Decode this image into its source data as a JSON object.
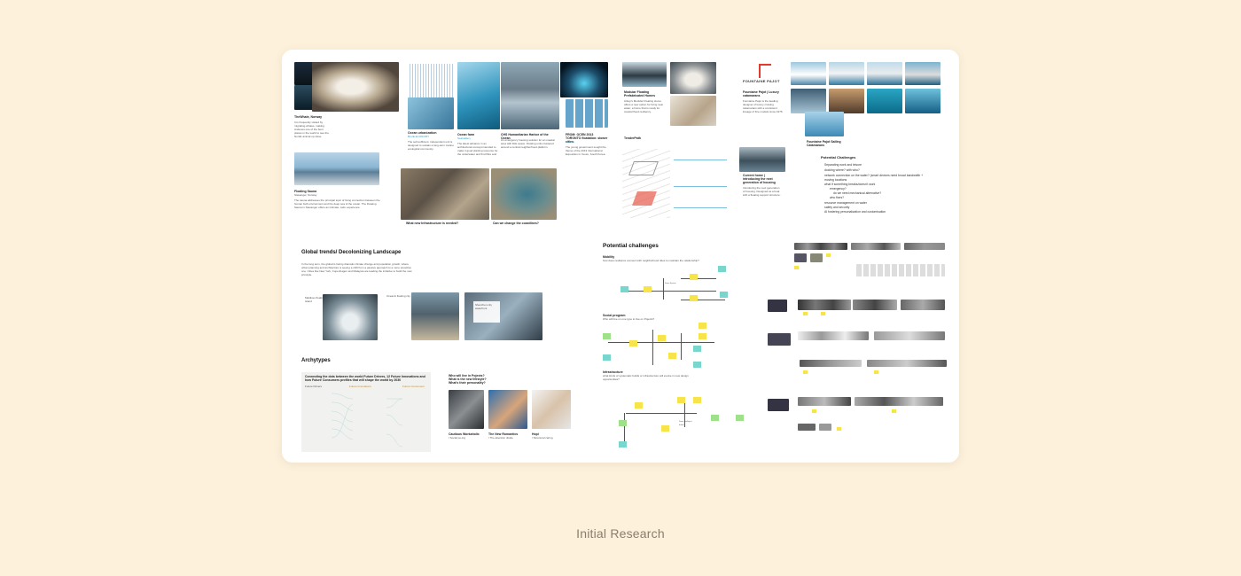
{
  "caption": "Initial Research",
  "board": {
    "col1": {
      "card1_title": "TheWhale, Norway",
      "card1_text": "It is frequently visited by migrating whales, making Andenes one of the best places in the world to see the Nordic animal up close.",
      "card2_title": "Floating Sauna",
      "card2_sub": "Stavanger, Norway",
      "card2_text": "The sauna addresses the principal topic of living connection between the human built environment and the deep sea of the ocean. The Floating Sauna in Stavanger offers an intimate, calm experience."
    },
    "col2": {
      "t1": "Ocean urbanization",
      "t1_link": "BLUE ECONOMY",
      "t1_text": "The self-sufficient, independent unit is designed to sustain a long-term marine ecological community.",
      "t2": "Ocean farm",
      "t2_link": "SeaGallery",
      "t2_text": "The latest advance in an architectural concept intended to make it good planting resource for the underwater and find fibre and forms.",
      "t3": "CHS Humanitarian Harbor of the Ocean",
      "t3_text": "An emergency housing solution for an coastal area with little space. Floating units clustered around a central neighborhood platform.",
      "t4": "FROM: OCEN 2013 TORONTO floatation: slower cities",
      "t4_link": "Toronto",
      "t4_text": "The young government sought the theme of the 2013 International Exposition in Yeosu, South Korea.",
      "caption_left": "What new Infrastructure is needed?",
      "caption_right": "Can we change the coastlines?"
    },
    "col3": {
      "t1": "Modular Floating Prefabricated Homes",
      "t1_text": "Arkup's Modular Floating Home offers a new option for living near water, a home that is ready for coastal flood resiliency.",
      "t2": "TenderPath",
      "t3": "Current home | introducing the next generation of housing",
      "t3_text": "Introducing the next generation of housing. Designed as a boat with a floating support structure."
    },
    "col4": {
      "logo": "FOUNTAINE PAJOT",
      "t1": "Fountaine Pajot | Luxury catamarans",
      "t1_text": "Fountaine Pajot is the leading designer of luxury cruising catamarans with a consistent lineage of fine models since 1976.",
      "t2": "Fountaine Pajot Sailing Catamarans",
      "challenges_title": "Potential Challenges",
      "challenges": [
        "Separating work and leisure",
        "docking where? with who?",
        "network connection on the water? (smart devices need broad bandwidth + moving locations",
        "what if something breaks/doesn't work",
        "emergency?",
        "do we need mechanical alternative?",
        "who fixes?",
        "resource management on water",
        "safety and security",
        "AI fostering personalization and customisation"
      ]
    },
    "section2": {
      "title": "Global trends/ Decolonizing Landscape",
      "text": "In the long term, the global is facing dramatic climate change and population growth, where urban planning and architecture is seeing a shift from a passive approach to a more proactive one. Cities like New York, Copenhagen and Malaysia are leading the initiative to build the new principle.",
      "label1": "Maldives floating island",
      "label2": "Oceanix floating city",
      "label3": "Shenzhen city waterfront"
    },
    "section3": {
      "title": "Archytypes",
      "chart_title": "Connecting the dots between the world Future Drivers, 12 Future Innovations and how Future Consumers profiles that will shape the world by 2030",
      "col_a": "Future Drivers",
      "col_b": "Future Innovations",
      "col_c": "Future Consumers",
      "q1": "Who will live in Pojects?",
      "q2": "What is the new lifestyle?",
      "q3": "What's their personality?",
      "p1": "Cautious Workaholic",
      "p1_sub": "/ Social pe-ing",
      "p2": "The New Romantics",
      "p2_sub": "/ The attention divide",
      "p3": "Hopi",
      "p3_sub": "/ Structural caring"
    },
    "section4": {
      "title": "Potential challenges",
      "g1_title": "Mobility",
      "g1_q": "how does resilience connect with neighborhood rides to maintain the relationship?",
      "g2_title": "Social program",
      "g2_q": "Who will live on one type to live on Pojects?",
      "g3_title": "Infrastructure",
      "g3_q": "what kinds of systematic builds or infrastructure will evolve in new design opportunities?"
    }
  },
  "colors": {
    "background": "#fdf1dc",
    "board": "#ffffff",
    "accent": "#2aa0d0",
    "sticky_yellow": "#f7e34a",
    "sticky_teal": "#79d6cc",
    "sticky_green": "#9fe08a",
    "logo_red": "#e23b2c"
  }
}
